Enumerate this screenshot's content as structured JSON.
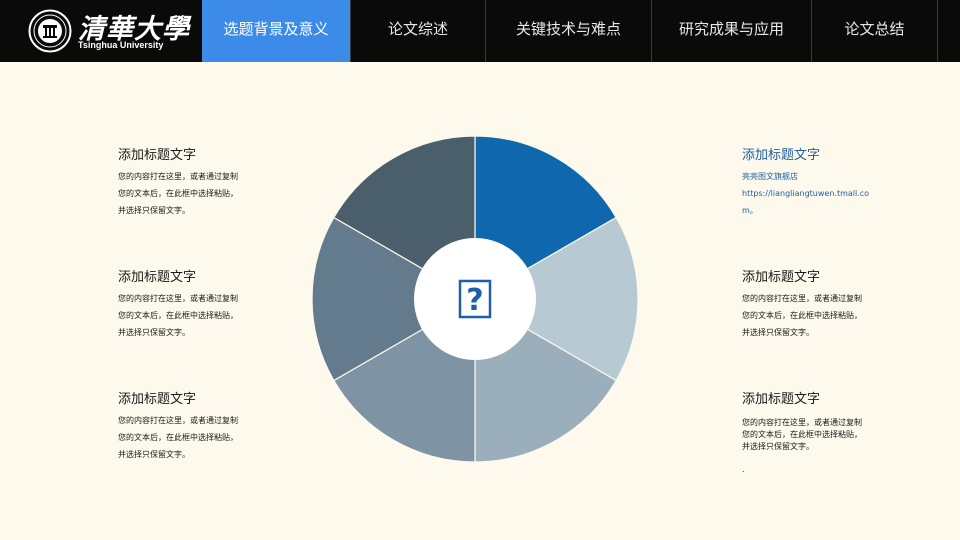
{
  "brand": {
    "cn": "清華大學",
    "en": "Tsinghua University"
  },
  "nav": {
    "tabs": [
      {
        "label": "选题背景及意义",
        "active": true
      },
      {
        "label": "论文综述",
        "active": false
      },
      {
        "label": "关键技术与难点",
        "active": false
      },
      {
        "label": "研究成果与应用",
        "active": false
      },
      {
        "label": "论文总结",
        "active": false
      }
    ]
  },
  "left_items": [
    {
      "title": "添加标题文字",
      "lines": [
        "您的内容打在这里，或者通过复制",
        "您的文本后，在此框中选择粘贴，",
        "并选择只保留文字。"
      ]
    },
    {
      "title": "添加标题文字",
      "lines": [
        "您的内容打在这里，或者通过复制",
        "您的文本后，在此框中选择粘贴，",
        "并选择只保留文字。"
      ]
    },
    {
      "title": "添加标题文字",
      "lines": [
        "您的内容打在这里，或者通过复制",
        "您的文本后，在此框中选择粘贴，",
        "并选择只保留文字。"
      ]
    }
  ],
  "right_items": [
    {
      "title": "添加标题文字",
      "lines": [
        "亮亮图文旗舰店",
        "https://liangliangtuwen.tmall.co",
        "m。"
      ]
    },
    {
      "title": "添加标题文字",
      "lines": [
        "您的内容打在这里，或者通过复制",
        "您的文本后，在此框中选择粘贴，",
        "并选择只保留文字。"
      ]
    },
    {
      "title": "添加标题文字",
      "lines": [
        "您的内容打在这里，或者通过复制",
        "您的文本后，在此框中选择粘贴，",
        "并选择只保留文字。"
      ],
      "trailing": "."
    }
  ],
  "center": {
    "icon": "missing-image-icon",
    "glyph": "?"
  },
  "colors": {
    "nav_bg": "#0a0a0a",
    "nav_active": "#3d8be8",
    "page_bg": "#fdf9ec",
    "accent_blue": "#1f5fa8",
    "segments": [
      "#0f68ad",
      "#b7c9d3",
      "#9aaebc",
      "#7e93a3",
      "#647b8e",
      "#4b5e6c"
    ]
  },
  "chart_data": {
    "type": "pie",
    "values": [
      1,
      1,
      1,
      1,
      1,
      1
    ],
    "colors": [
      "#0f68ad",
      "#b7c9d3",
      "#9aaebc",
      "#7e93a3",
      "#647b8e",
      "#4b5e6c"
    ]
  }
}
